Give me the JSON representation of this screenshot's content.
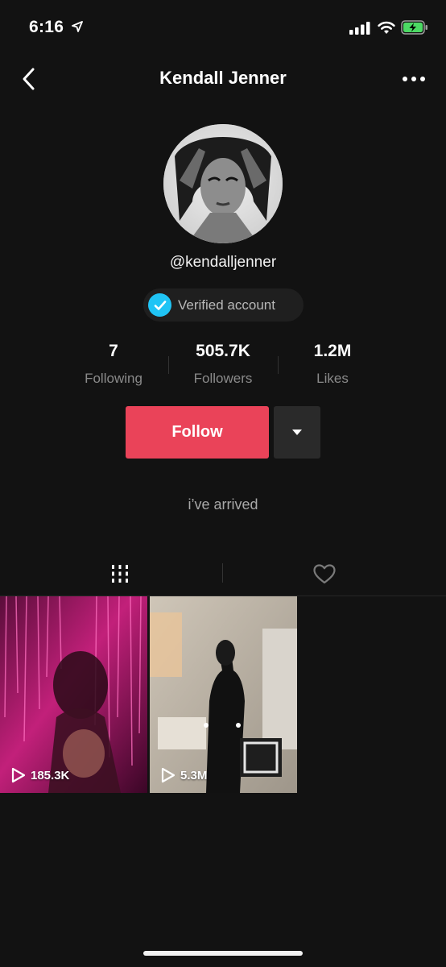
{
  "status_bar": {
    "time": "6:16",
    "battery_color": "#4cd964"
  },
  "header": {
    "title": "Kendall Jenner"
  },
  "profile": {
    "username": "@kendalljenner",
    "verified_label": "Verified account",
    "bio": "i’ve arrived"
  },
  "stats": [
    {
      "value": "7",
      "label": "Following"
    },
    {
      "value": "505.7K",
      "label": "Followers"
    },
    {
      "value": "1.2M",
      "label": "Likes"
    }
  ],
  "actions": {
    "follow_label": "Follow"
  },
  "tabs": {
    "active": "videos-grid",
    "icons": [
      "grid-icon",
      "heart-icon"
    ]
  },
  "videos": [
    {
      "views": "185.3K"
    },
    {
      "views": "5.3M"
    }
  ],
  "colors": {
    "background": "#121212",
    "follow": "#ea4359",
    "verified": "#20c4f5"
  }
}
